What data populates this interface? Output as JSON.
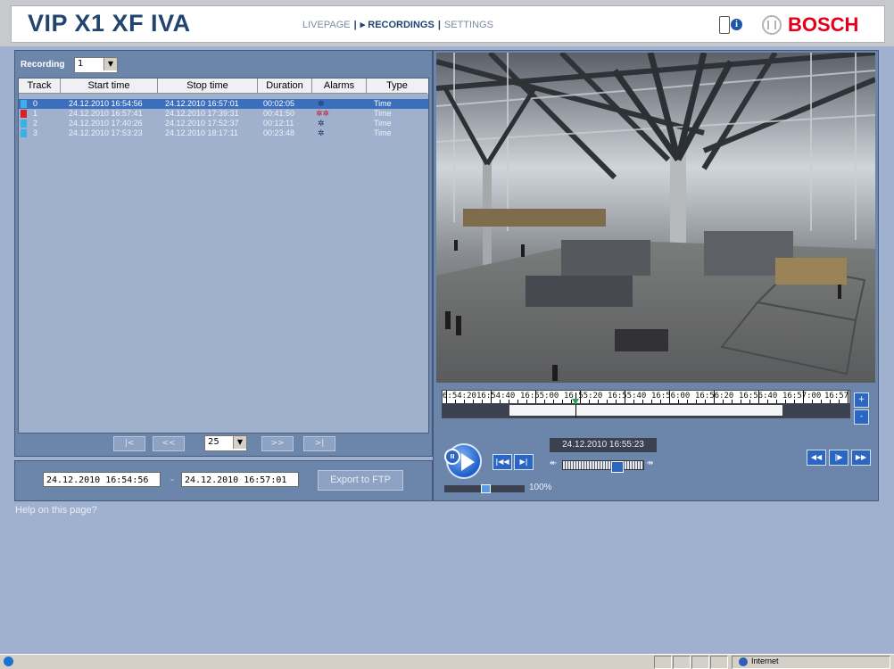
{
  "header": {
    "title": "VIP X1 XF IVA",
    "nav": {
      "livepage": "LIVEPAGE",
      "recordings": "▸ RECORDINGS",
      "settings": "SETTINGS",
      "sep": "|"
    },
    "info_icon_glyph": "i",
    "brand": "BOSCH",
    "brand_color": "#e1001a"
  },
  "recording": {
    "label": "Recording",
    "selected": "1"
  },
  "table": {
    "columns": [
      "Track",
      "Start time",
      "Stop time",
      "Duration",
      "Alarms",
      "Type"
    ],
    "rows": [
      {
        "track": "0",
        "start": "24.12.2010 16:54:56",
        "stop": "24.12.2010 16:57:01",
        "duration": "00:02:05",
        "alarm": "✲",
        "type": "Time"
      },
      {
        "track": "1",
        "start": "24.12.2010 16:57:41",
        "stop": "24.12.2010 17:39:31",
        "duration": "00:41:50",
        "alarm": "✲✲",
        "type": "Time"
      },
      {
        "track": "2",
        "start": "24.12.2010 17:40:26",
        "stop": "24.12.2010 17:52:37",
        "duration": "00:12:11",
        "alarm": "✲",
        "type": "Time"
      },
      {
        "track": "3",
        "start": "24.12.2010 17:53:23",
        "stop": "24.12.2010 18:17:11",
        "duration": "00:23:48",
        "alarm": "✲",
        "type": "Time"
      }
    ]
  },
  "pager": {
    "first": "|<",
    "prev": "<<",
    "page_size": "25",
    "next": ">>",
    "last": ">|"
  },
  "export": {
    "start": "24.12.2010 16:54:56",
    "dash": "-",
    "stop": "24.12.2010 16:57:01",
    "button": "Export to FTP"
  },
  "help": "Help on this page?",
  "timeline": {
    "labels": [
      "6:54:20",
      "16:54:40",
      "16:55:00",
      "16:55:20",
      "16:55:40",
      "16:56:00",
      "16:56:20",
      "16:56:40",
      "16:57:00",
      "16:57"
    ],
    "zoom_in": "+",
    "zoom_out": "-"
  },
  "player": {
    "timestamp": "24.12.2010 16:55:23",
    "pause_glyph": "II",
    "prev_track": "|◀◀",
    "next_track": "▶|",
    "rewind": "◀◀",
    "frame": "|▶",
    "forward": "▶▶",
    "volume": "100%"
  },
  "statusbar": {
    "zone": "Internet"
  }
}
